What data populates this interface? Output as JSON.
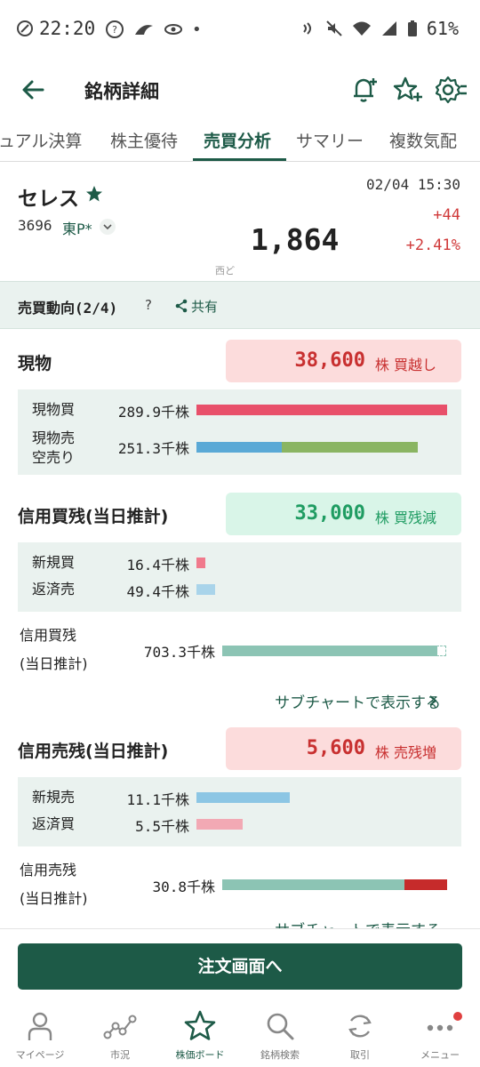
{
  "status_bar": {
    "time": "22:20",
    "battery": "61%"
  },
  "header": {
    "title": "銘柄詳細"
  },
  "tabs": [
    {
      "label": "ュアル決算"
    },
    {
      "label": "株主優待"
    },
    {
      "label": "売買分析"
    },
    {
      "label": "サマリー"
    },
    {
      "label": "複数気配"
    }
  ],
  "stock": {
    "name": "セレス",
    "code": "3696",
    "market": "東P*",
    "price": "1,864",
    "price_sub": "西ど",
    "datetime": "02/04 15:30",
    "change": "+44",
    "change_pct": "+2.41%"
  },
  "trend": {
    "title": "売買動向(2/4)",
    "help": "?",
    "share": "共有"
  },
  "genbutsu": {
    "title": "現物",
    "pill_value": "38,600",
    "pill_unit": "株 買越し",
    "rows": [
      {
        "label": "現物買",
        "value": "289.9千株",
        "bar_fraction": 1.0
      },
      {
        "label": "現物売\n空売り",
        "value": "251.3千株",
        "bar_fraction": 0.87,
        "split_fraction": 0.38
      }
    ]
  },
  "margin_buy": {
    "title": "信用買残(当日推計)",
    "pill_value": "33,000",
    "pill_unit": "株 買残減",
    "rows": [
      {
        "label": "新規買",
        "value": "16.4千株"
      },
      {
        "label": "返済売",
        "value": "49.4千株"
      }
    ],
    "balance_label_1": "信用買残",
    "balance_label_2": "(当日推計)",
    "balance_value": "703.3千株",
    "link": "サブチャートで表示する"
  },
  "margin_sell": {
    "title": "信用売残(当日推計)",
    "pill_value": "5,600",
    "pill_unit": "株 売残増",
    "rows": [
      {
        "label": "新規売",
        "value": "11.1千株"
      },
      {
        "label": "返済買",
        "value": "5.5千株"
      }
    ],
    "balance_label_1": "信用売残",
    "balance_label_2": "(当日推計)",
    "balance_value": "30.8千株",
    "link": "サブチャートで表示する"
  },
  "order_button": "注文画面へ",
  "bottom_nav": [
    {
      "label": "マイページ",
      "icon": "person-icon"
    },
    {
      "label": "市況",
      "icon": "market-chart-icon"
    },
    {
      "label": "株価ボード",
      "icon": "star-board-icon"
    },
    {
      "label": "銘柄検索",
      "icon": "search-icon"
    },
    {
      "label": "取引",
      "icon": "trade-refresh-icon"
    },
    {
      "label": "メニュー",
      "icon": "menu-dots-icon"
    }
  ],
  "colors": {
    "brand": "#1d5a47",
    "up_red": "#d03a3a",
    "buy_bar": "#e8506a",
    "sell_bar": "#5aa9d6",
    "short_bar": "#8ab562",
    "balance_bar": "#8cc4b4"
  }
}
